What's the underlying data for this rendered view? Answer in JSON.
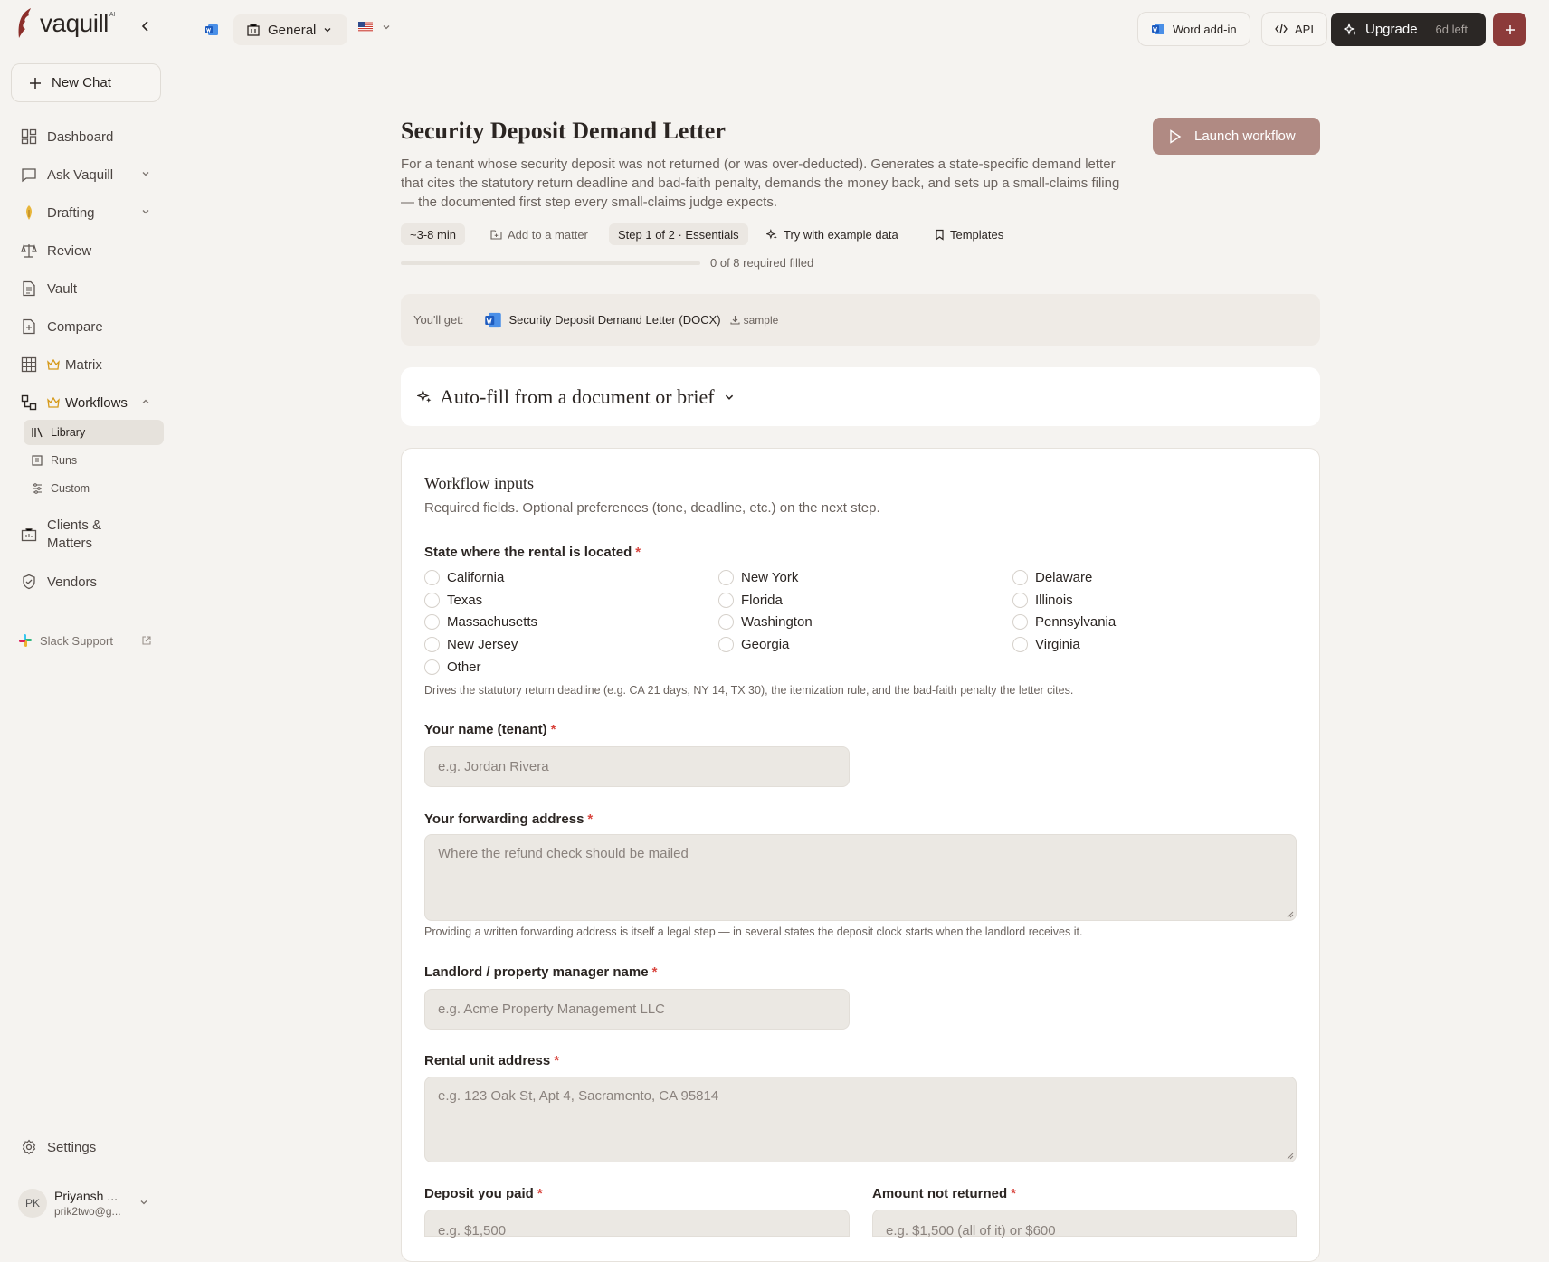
{
  "app": {
    "logo_text": "vaquill",
    "logo_sup": "AI"
  },
  "sidebar": {
    "new_chat": "New Chat",
    "items": [
      {
        "label": "Dashboard"
      },
      {
        "label": "Ask Vaquill"
      },
      {
        "label": "Drafting"
      },
      {
        "label": "Review"
      },
      {
        "label": "Vault"
      },
      {
        "label": "Compare"
      },
      {
        "label": "Matrix"
      },
      {
        "label": "Workflows"
      },
      {
        "label": "Clients &"
      },
      {
        "label": "Matters"
      },
      {
        "label": "Vendors"
      }
    ],
    "subitems": [
      {
        "label": "Library"
      },
      {
        "label": "Runs"
      },
      {
        "label": "Custom"
      }
    ],
    "slack": "Slack Support",
    "settings": "Settings",
    "user": {
      "initials": "PK",
      "name": "Priyansh ...",
      "email": "prik2two@g..."
    }
  },
  "topbar": {
    "workspace": "General",
    "word_addin": "Word add-in",
    "api": "API",
    "upgrade": "Upgrade",
    "days_left": "6d left"
  },
  "main": {
    "title": "Security Deposit Demand Letter",
    "description": "For a tenant whose security deposit was not returned (or was over-deducted). Generates a state-specific demand letter that cites the statutory return deadline and bad-faith penalty, demands the money back, and sets up a small-claims filing — the documented first step every small-claims judge expects.",
    "launch": "Launch workflow",
    "duration": "~3-8 min",
    "add_matter": "Add to a matter",
    "step": "Step 1 of 2 · Essentials",
    "try_example": "Try with example data",
    "templates": "Templates",
    "progress": {
      "filled": 0,
      "required": 8,
      "label": "0 of 8 required filled"
    },
    "you_get_label": "You'll get:",
    "output_doc": "Security Deposit Demand Letter (DOCX)",
    "sample": "sample",
    "autofill": "Auto-fill from a document or brief"
  },
  "form": {
    "title": "Workflow inputs",
    "subtitle": "Required fields. Optional preferences (tone, deadline, etc.) on the next step.",
    "required_mark": "*",
    "state": {
      "label": "State where the rental is located",
      "options": [
        "California",
        "New York",
        "Delaware",
        "Texas",
        "Florida",
        "Illinois",
        "Massachusetts",
        "Washington",
        "Pennsylvania",
        "New Jersey",
        "Georgia",
        "Virginia",
        "Other"
      ],
      "help": "Drives the statutory return deadline (e.g. CA 21 days, NY 14, TX 30), the itemization rule, and the bad-faith penalty the letter cites."
    },
    "name": {
      "label": "Your name (tenant)",
      "placeholder": "e.g. Jordan Rivera"
    },
    "forwarding": {
      "label": "Your forwarding address",
      "placeholder": "Where the refund check should be mailed",
      "help": "Providing a written forwarding address is itself a legal step — in several states the deposit clock starts when the landlord receives it."
    },
    "landlord": {
      "label": "Landlord / property manager name",
      "placeholder": "e.g. Acme Property Management LLC"
    },
    "unit": {
      "label": "Rental unit address",
      "placeholder": "e.g. 123 Oak St, Apt 4, Sacramento, CA 95814"
    },
    "deposit": {
      "label": "Deposit you paid",
      "placeholder": "e.g. $1,500"
    },
    "not_returned": {
      "label": "Amount not returned",
      "placeholder": "e.g. $1,500 (all of it) or $600"
    }
  },
  "colors": {
    "accent": "#8c3b3a",
    "launch": "#b08a83",
    "bg": "#f5f3f0",
    "required": "#d9463f"
  }
}
